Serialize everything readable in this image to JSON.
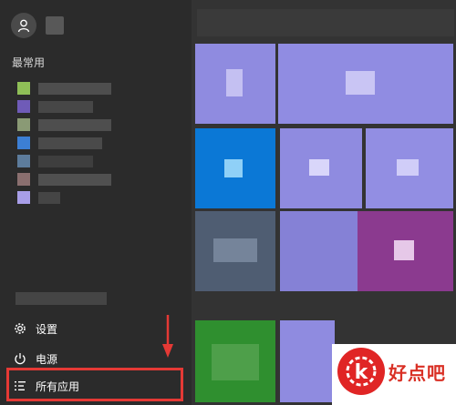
{
  "left_pane": {
    "most_used_heading": "最常用",
    "app_icon_colors": [
      "#8fbf57",
      "#6f5bb8",
      "#8a9a75",
      "#3c7fd4",
      "#5d7c9c",
      "#8a6f6f",
      "#a89ee8"
    ],
    "nav": {
      "settings_label": "设置",
      "power_label": "电源",
      "all_apps_label": "所有应用"
    }
  },
  "tiles": {
    "accent_purple": "#8f8be0",
    "accent_blue": "#0b78d6",
    "accent_magenta": "#8b3a8f",
    "accent_green": "#2f8f2f"
  },
  "annotation": {
    "highlight_color": "#e53935"
  },
  "watermark": {
    "brand_text": "好点吧",
    "logo_letter": "k"
  }
}
